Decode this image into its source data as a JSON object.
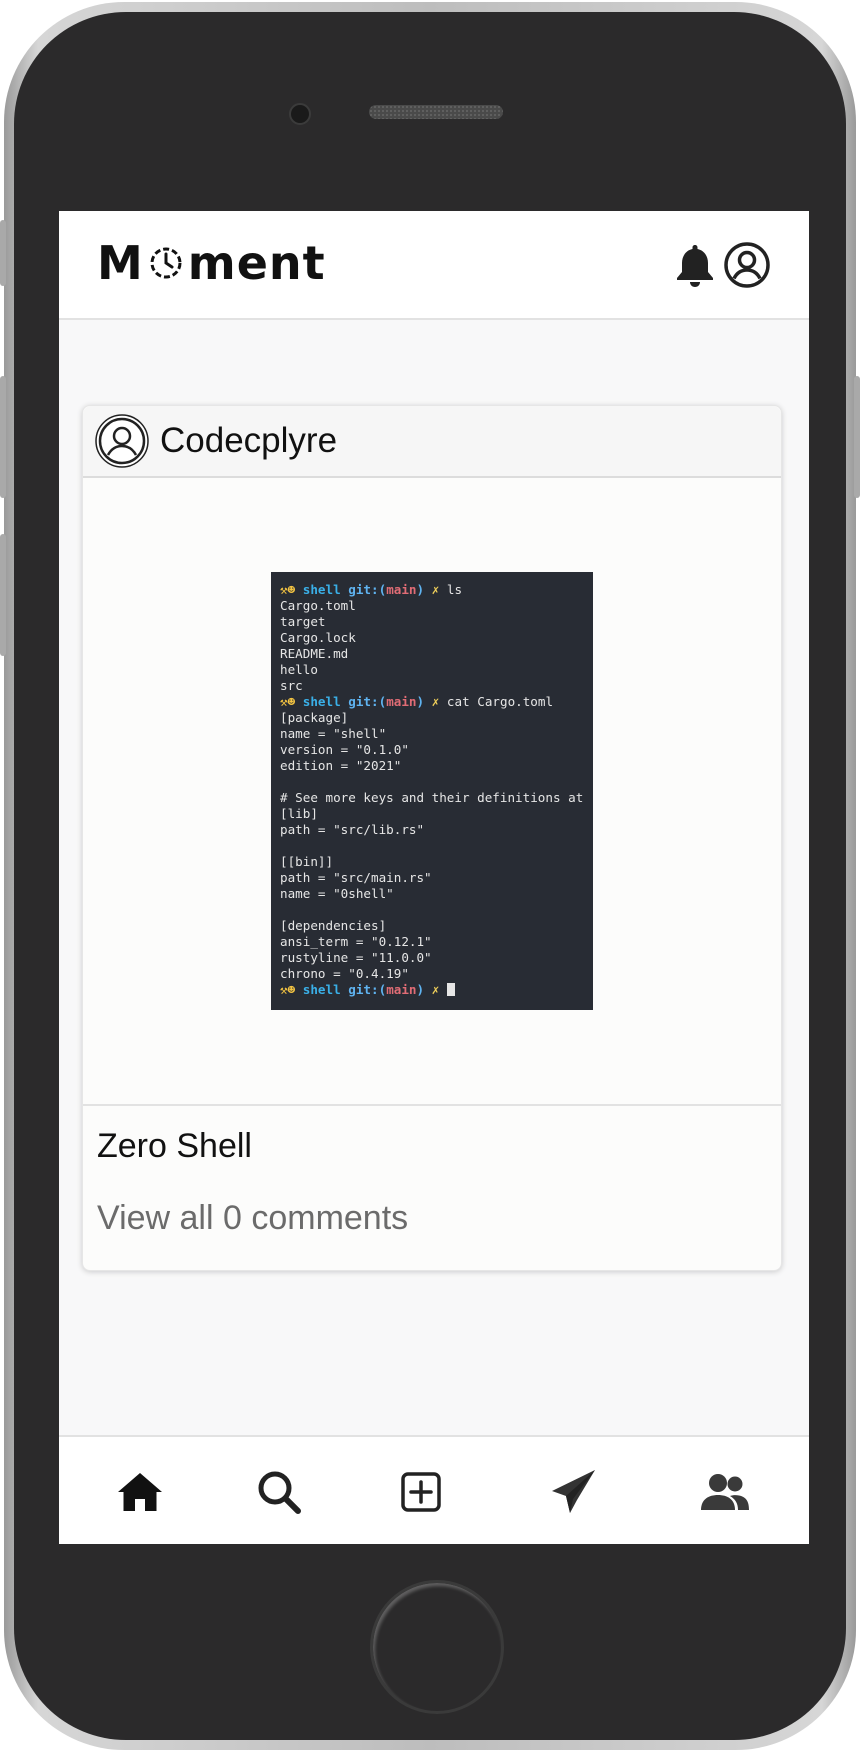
{
  "app": {
    "name": "Moment",
    "logo_left": "M",
    "logo_right": "ment"
  },
  "header": {
    "icons": [
      "bell-icon",
      "profile-icon"
    ]
  },
  "post": {
    "username": "Codecplyre",
    "caption": "Zero Shell",
    "comments_link": "View all 0 comments",
    "image": {
      "type": "terminal-screenshot",
      "lines": [
        "ls",
        "Cargo.toml",
        "target",
        "Cargo.lock",
        "README.md",
        "hello",
        "src",
        "cat Cargo.toml",
        "[package]",
        "name = \"shell\"",
        "version = \"0.1.0\"",
        "edition = \"2021\"",
        "",
        "# See more keys and their definitions at",
        "[lib]",
        "path = \"src/lib.rs\"",
        "",
        "[[bin]]",
        "path = \"src/main.rs\"",
        "name = \"0shell\"",
        "",
        "[dependencies]",
        "ansi_term = \"0.12.1\"",
        "rustyline = \"11.0.0\"",
        "chrono = \"0.4.19\""
      ],
      "prompt": {
        "dir": "shell",
        "git": "git:(",
        "branch": "main",
        "git_close": ")",
        "mark": "✗"
      }
    }
  },
  "bottom_nav": {
    "items": [
      "home-icon",
      "search-icon",
      "add-post-icon",
      "send-icon",
      "users-icon"
    ]
  },
  "colors": {
    "terminal_bg": "#282c34",
    "prompt_dir": "#3ab0e8",
    "prompt_branch": "#e06c75",
    "prompt_mark": "#f0d05a",
    "comments_text": "#6b6b6b"
  }
}
